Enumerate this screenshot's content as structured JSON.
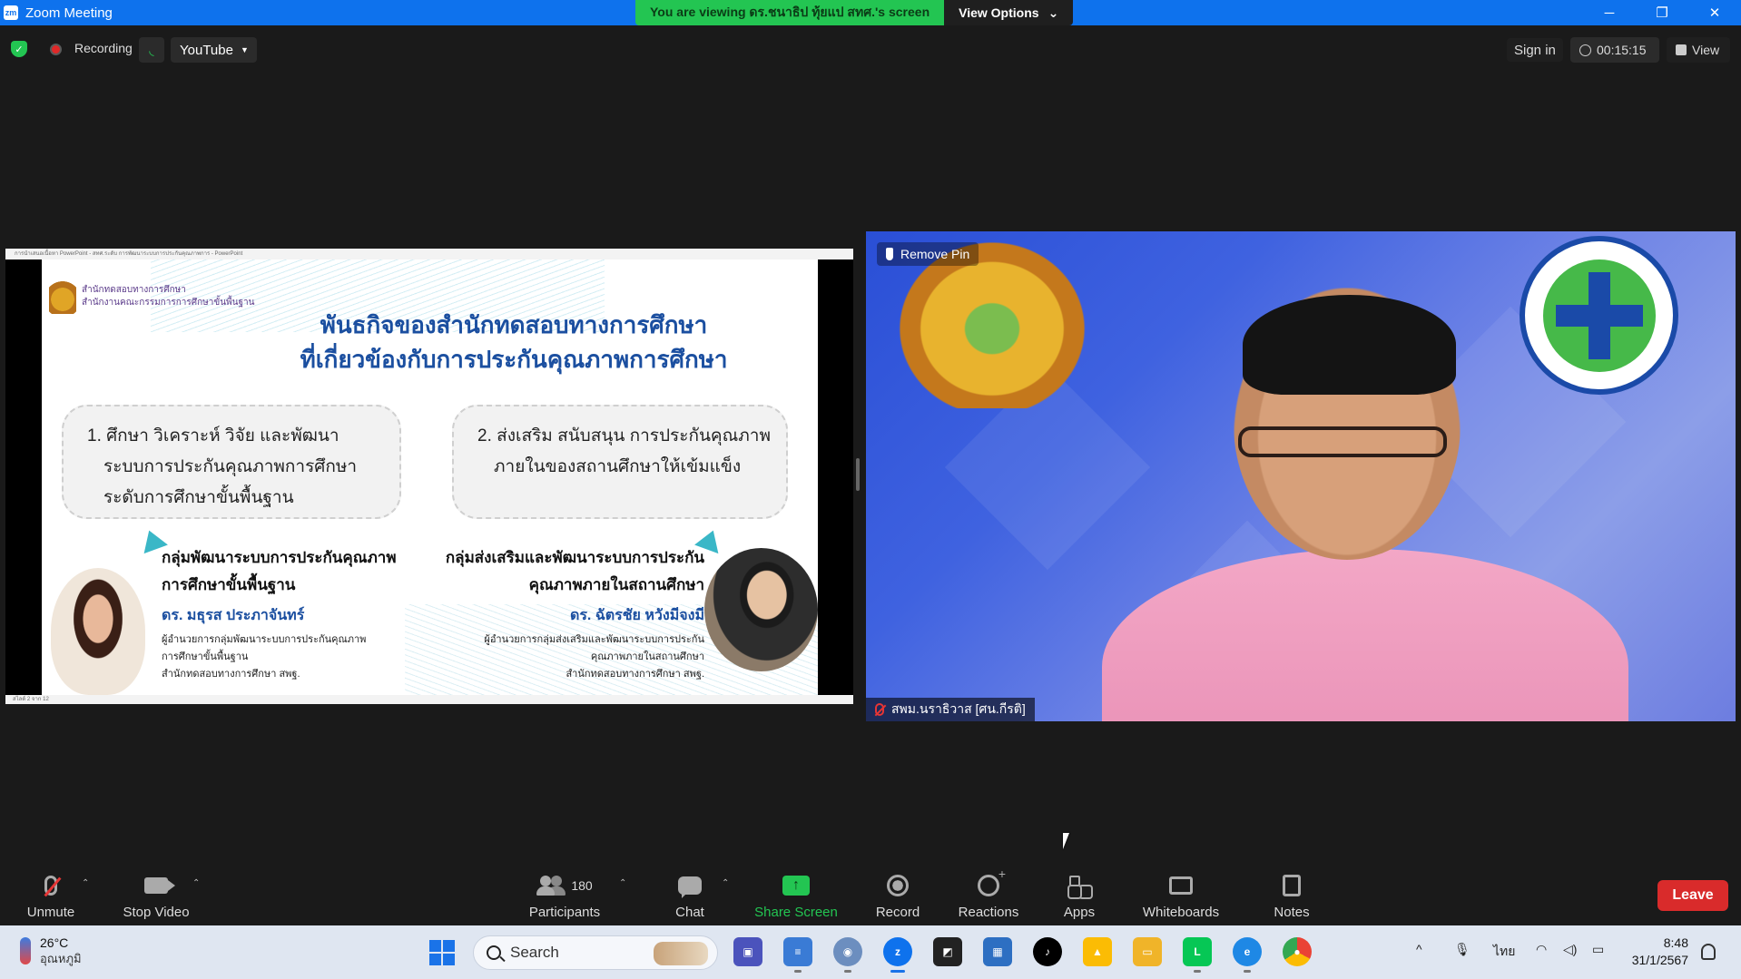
{
  "window": {
    "title": "Zoom Meeting",
    "logo": "zm",
    "viewing_banner": "You are viewing ดร.ชนาธิป ทุ้ยแป สทศ.'s screen",
    "view_options": "View Options",
    "controls": [
      "─",
      "❐",
      "✕"
    ]
  },
  "status_bar": {
    "recording_label": "Recording",
    "stream_dropdown": "YouTube",
    "sign_in": "Sign in",
    "elapsed": "00:15:15",
    "view_label": "View"
  },
  "slide": {
    "app_bar": "การนำเสนอเนื้อหา PowerPoint - สทศ.ระดับ การพัฒนาระบบการประกันคุณภาพการ - PowerPoint",
    "org_line1": "สำนักทดสอบทางการศึกษา",
    "org_line2": "สำนักงานคณะกรรมการการศึกษาขั้นพื้นฐาน",
    "title_line1": "พันธกิจของสำนักทดสอบทางการศึกษา",
    "title_line2": "ที่เกี่ยวข้องกับการประกันคุณภาพการศึกษา",
    "box1_line1": "1. ศึกษา วิเคราะห์ วิจัย และพัฒนา",
    "box1_line2": "ระบบการประกันคุณภาพการศึกษา",
    "box1_line3": "ระดับการศึกษาขั้นพื้นฐาน",
    "box2_line1": "2. ส่งเสริม สนับสนุน การประกันคุณภาพ",
    "box2_line2": "ภายในของสถานศึกษาให้เข้มแข็ง",
    "group1_line1": "กลุ่มพัฒนาระบบการประกันคุณภาพ",
    "group1_line2": "การศึกษาขั้นพื้นฐาน",
    "person1": "ดร. มธุรส  ประภาจันทร์",
    "role1_line1": "ผู้อำนวยการกลุ่มพัฒนาระบบการประกันคุณภาพ",
    "role1_line2": "การศึกษาขั้นพื้นฐาน",
    "role1_line3": "สำนักทดสอบทางการศึกษา สพฐ.",
    "group2_line1": "กลุ่มส่งเสริมและพัฒนาระบบการประกัน",
    "group2_line2": "คุณภาพภายในสถานศึกษา",
    "person2": "ดร. ฉัตรชัย  หวังมีจงมี",
    "role2_line1": "ผู้อำนวยการกลุ่มส่งเสริมและพัฒนาระบบการประกัน",
    "role2_line2": "คุณภาพภายในสถานศึกษา",
    "role2_line3": "สำนักทดสอบทางการศึกษา สพฐ.",
    "footer": "สไลด์ 2 จาก 12"
  },
  "video": {
    "remove_pin": "Remove Pin",
    "participant_name": "สพม.นราธิวาส [ศน.กีรติ]"
  },
  "toolbar": {
    "unmute": "Unmute",
    "stop_video": "Stop Video",
    "participants": "Participants",
    "participant_count": "180",
    "chat": "Chat",
    "share_screen": "Share Screen",
    "record": "Record",
    "reactions": "Reactions",
    "apps": "Apps",
    "whiteboards": "Whiteboards",
    "notes": "Notes",
    "leave": "Leave",
    "caret": "⌃"
  },
  "taskbar": {
    "temperature": "26°C",
    "weather_desc": "อุณหภูมิ",
    "search_placeholder": "Search",
    "input_lang": "ไทย",
    "time": "8:48",
    "date": "31/1/2567",
    "tray_chevron": "^"
  },
  "colors": {
    "zoom_blue": "#0e72ed",
    "banner_green": "#23c552",
    "leave_red": "#d92b2b"
  }
}
